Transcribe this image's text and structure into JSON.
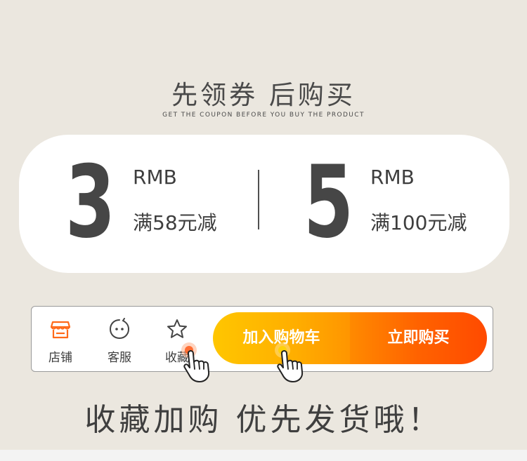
{
  "header": {
    "title": "先领券 后购买",
    "subtitle": "GET THE COUPON BEFORE YOU BUY THE PRODUCT"
  },
  "coupons": [
    {
      "amount": "3",
      "unit": "RMB",
      "condition": "满58元减"
    },
    {
      "amount": "5",
      "unit": "RMB",
      "condition": "满100元减"
    }
  ],
  "action_bar": {
    "store": {
      "label": "店铺",
      "icon": "store-icon"
    },
    "service": {
      "label": "客服",
      "icon": "chat-face-icon"
    },
    "favorite": {
      "label": "收藏",
      "icon": "star-icon"
    },
    "add_to_cart": "加入购物车",
    "buy_now": "立即购买"
  },
  "footer": {
    "text": "收藏加购 优先发货哦！"
  },
  "colors": {
    "background": "#ebe7df",
    "cart_gradient": [
      "#ffc600",
      "#ff9500"
    ],
    "buy_gradient": [
      "#ff8a00",
      "#ff4a00"
    ],
    "store_icon": "#ff6a1a"
  }
}
